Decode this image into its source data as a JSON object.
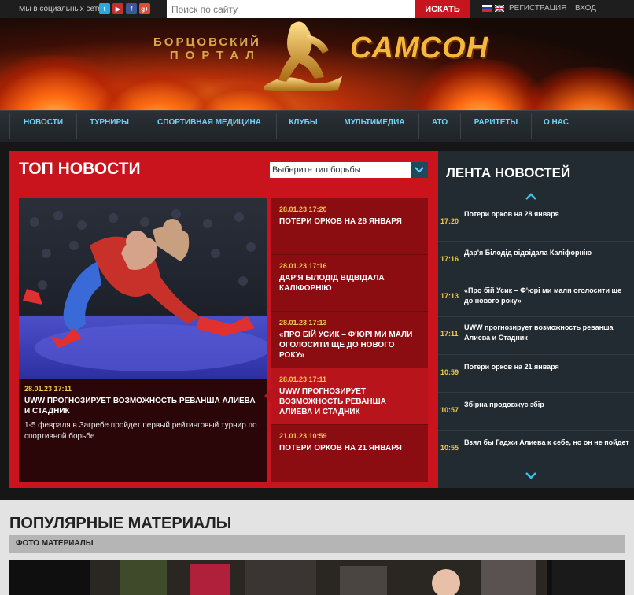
{
  "topbar": {
    "social_label": "Мы в социальных сетях:",
    "social_icons": [
      "twitter-icon",
      "youtube-icon",
      "facebook-icon",
      "google-plus-icon"
    ],
    "search_placeholder": "Поиск по сайту",
    "search_button": "ИСКАТЬ",
    "languages": [
      "ru-flag",
      "en-flag"
    ],
    "register": "РЕГИСТРАЦИЯ",
    "login": "ВХОД"
  },
  "banner": {
    "portal_line1": "БОРЦОВСКИЙ",
    "portal_line2": "ПОРТАЛ",
    "logo_text": "САМСОН"
  },
  "nav": {
    "items": [
      "НОВОСТИ",
      "ТУРНИРЫ",
      "СПОРТИВНАЯ МЕДИЦИНА",
      "КЛУБЫ",
      "МУЛЬТИМЕДИА",
      "АТО",
      "РАРИТЕТЫ",
      "О НАС"
    ]
  },
  "top_news": {
    "title": "ТОП НОВОСТИ",
    "select_value": "Выберите тип борьбы",
    "featured": {
      "time": "28.01.23 17:11",
      "title": "UWW ПРОГНОЗИРУЕТ ВОЗМОЖНОСТЬ РЕВАНША АЛИЕВА И СТАДНИК",
      "description": "1-5 февраля в Загребе пройдет первый рейтинговый турнир по спортивной борьбе"
    },
    "list": [
      {
        "time": "28.01.23 17:20",
        "title": "ПОТЕРИ ОРКОВ НА 28 ЯНВАРЯ"
      },
      {
        "time": "28.01.23 17:16",
        "title": "ДАР'Я БІЛОДІД ВІДВІДАЛА КАЛІФОРНІЮ"
      },
      {
        "time": "28.01.23 17:13",
        "title": "«ПРО БІЙ УСИК – Ф'ЮРІ МИ МАЛИ ОГОЛОСИТИ ЩЕ ДО НОВОГО РОКУ»"
      },
      {
        "time": "28.01.23 17:11",
        "title": "UWW ПРОГНОЗИРУЕТ ВОЗМОЖНОСТЬ РЕВАНША АЛИЕВА И СТАДНИК"
      },
      {
        "time": "21.01.23 10:59",
        "title": "ПОТЕРИ ОРКОВ НА 21 ЯНВАРЯ"
      }
    ]
  },
  "feed": {
    "title": "ЛЕНТА НОВОСТЕЙ",
    "items": [
      {
        "time": "17:20",
        "text": "Потери орков на 28 января"
      },
      {
        "time": "17:16",
        "text": "Дар'я Білодід відвідала Каліфорнію"
      },
      {
        "time": "17:13",
        "text": "«Про бій Усик – Ф'юрі ми мали оголосити ще до нового року»"
      },
      {
        "time": "17:11",
        "text": "UWW прогнозирует возможность реванша Алиева и Стадник"
      },
      {
        "time": "10:59",
        "text": "Потери орков на 21 января"
      },
      {
        "time": "10:57",
        "text": "Збірна продовжує збір"
      },
      {
        "time": "10:55",
        "text": "Взял бы Гаджи Алиева к себе, но он не пойдет"
      }
    ]
  },
  "popular": {
    "title": "ПОПУЛЯРНЫЕ МАТЕРИАЛЫ",
    "tab": "ФОТО МАТЕРИАЛЫ"
  },
  "colors": {
    "accent_red": "#c9141e",
    "nav_link": "#6fd3f5",
    "time_yellow": "#f1c94e",
    "feed_bg": "#222b31"
  }
}
